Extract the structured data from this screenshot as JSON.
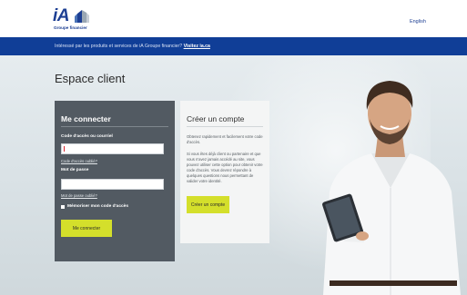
{
  "header": {
    "logo_text": "iA",
    "logo_subtitle": "Groupe financier",
    "language_link": "English"
  },
  "banner": {
    "text": "Intéressé par les produits et services de iA Groupe financier?",
    "link": "Visitez ia.ca"
  },
  "page": {
    "title": "Espace client"
  },
  "login": {
    "title": "Me connecter",
    "username_label": "Code d'accès ou courriel",
    "username_value": "",
    "forgot_code_link": "Code d'accès oublié?",
    "password_label": "Mot de passe",
    "password_value": "",
    "forgot_password_link": "Mot de passe oublié?",
    "remember_label": "Mémoriser mon code d'accès",
    "remember_checked": false,
    "submit_label": "Me connecter"
  },
  "create_account": {
    "title": "Créer un compte",
    "intro": "Obtenez rapidement et facilement votre code d'accès.",
    "details": "Si vous êtes déjà client ou partenaire et que vous n'avez jamais accédé au site, vous pouvez utiliser cette option pour obtenir votre code d'accès. Vous devrez répondre à quelques questions nous permettant de valider votre identité.",
    "button_label": "Créer un compte"
  },
  "colors": {
    "brand_blue": "#103e97",
    "accent_lime": "#d4df2b",
    "login_panel": "#525a62"
  }
}
